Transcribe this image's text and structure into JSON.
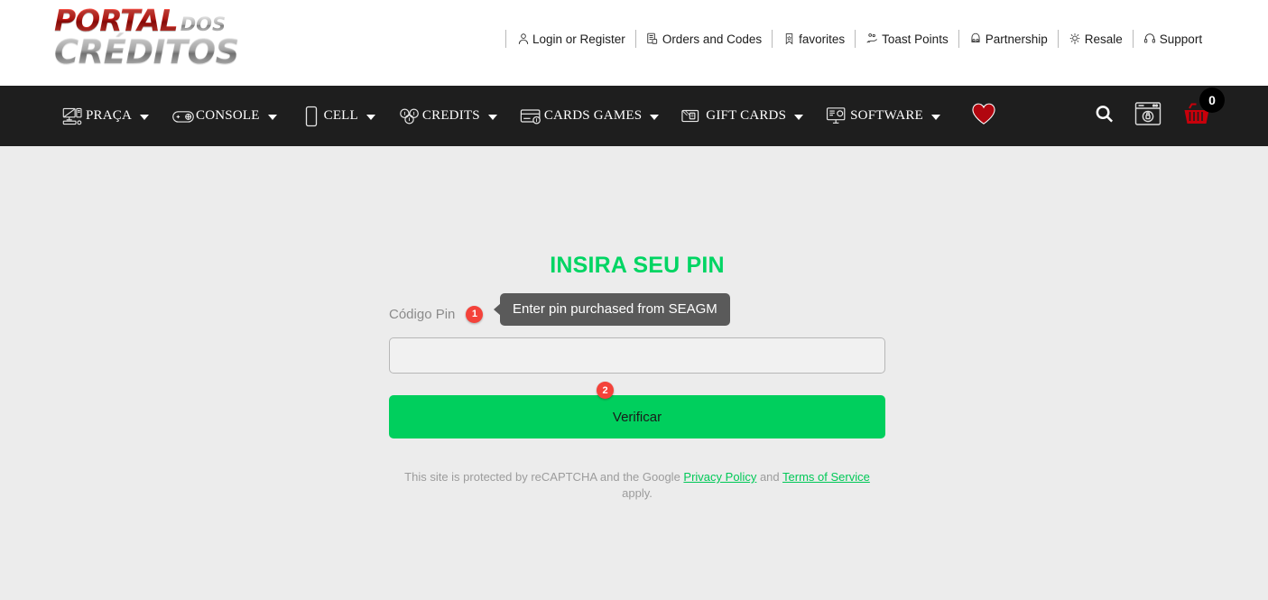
{
  "brand": {
    "logo_line1_primary": "PORTAL",
    "logo_line1_secondary": "DOS",
    "logo_line2": "CRÉDITOS",
    "accent_red": "#e8201a",
    "accent_silver": "#c9c9c9"
  },
  "top_links": [
    {
      "label": "Login or Register",
      "icon": "user-icon"
    },
    {
      "label": "Orders and Codes",
      "icon": "orders-icon"
    },
    {
      "label": "favorites",
      "icon": "bookmark-star-icon"
    },
    {
      "label": "Toast Points",
      "icon": "toast-points-icon"
    },
    {
      "label": "Partnership",
      "icon": "partnership-icon"
    },
    {
      "label": "Resale",
      "icon": "resale-icon"
    },
    {
      "label": "Support",
      "icon": "headset-icon"
    }
  ],
  "main_nav": {
    "background": "#1e1e1e",
    "items": [
      {
        "label": "PRAÇA",
        "icon": "desktop-computer-icon",
        "has_caret": true
      },
      {
        "label": "CONSOLE",
        "icon": "gamepad-icon",
        "has_caret": true
      },
      {
        "label": "CELL",
        "icon": "mobile-phone-icon",
        "has_caret": true
      },
      {
        "label": "CREDITS",
        "icon": "coins-icon",
        "has_caret": true
      },
      {
        "label": "CARDS GAMES",
        "icon": "credit-card-icon",
        "has_caret": true
      },
      {
        "label": "GIFT CARDS",
        "icon": "gift-cards-icon",
        "has_caret": true
      },
      {
        "label": "SOFTWARE",
        "icon": "monitor-software-icon",
        "has_caret": true
      }
    ],
    "favorites_icon": "heart-icon",
    "favorites_color": "#b1060f",
    "right_actions": [
      {
        "icon": "search-icon",
        "label": "Search"
      },
      {
        "icon": "secure-login-window-icon",
        "label": "Secure area"
      },
      {
        "icon": "shopping-basket-icon",
        "label": "Cart"
      }
    ],
    "cart_count": "0"
  },
  "main": {
    "title": "INSIRA SEU PIN",
    "title_color": "#00d563",
    "field_label": "Código Pin",
    "step_badge_1": "1",
    "tooltip_text": "Enter pin purchased from SEAGM",
    "pin_input_value": "",
    "pin_input_placeholder": "",
    "verify_label": "Verificar",
    "step_badge_2": "2",
    "verify_color": "#00cf5d"
  },
  "recaptcha": {
    "prefix": "This site is protected by reCAPTCHA and the Google ",
    "privacy_link": "Privacy Policy",
    "middle": " and ",
    "terms_link": "Terms of Service",
    "suffix": " apply."
  }
}
